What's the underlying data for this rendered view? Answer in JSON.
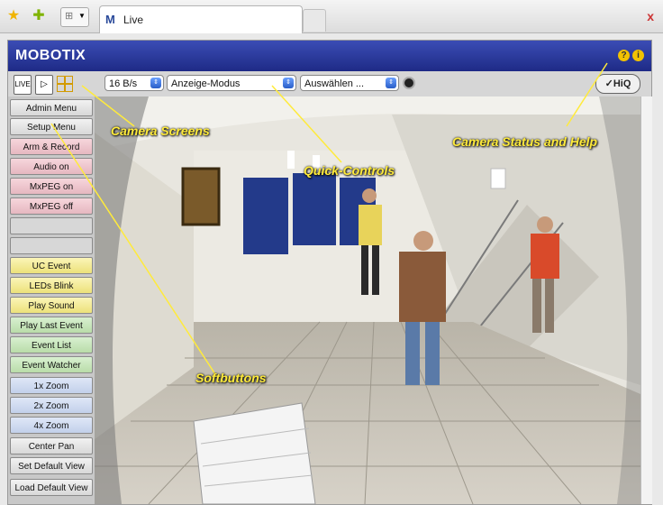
{
  "browser": {
    "tab_title": "Live",
    "close_symbol": "x"
  },
  "app": {
    "logo": "MOBOTIX",
    "help_symbol": "?",
    "info_symbol": "i"
  },
  "toolbar": {
    "rate": "16 B/s",
    "display_mode": "Anzeige-Modus",
    "select": "Auswählen ...",
    "quality": "✓HiQ",
    "live_btn": "LIVE"
  },
  "softbuttons": [
    {
      "label": "Admin Menu",
      "style": "g"
    },
    {
      "label": "Setup Menu",
      "style": "g"
    },
    {
      "label": "Arm & Record",
      "style": "p"
    },
    {
      "label": "Audio on",
      "style": "p"
    },
    {
      "label": "MxPEG on",
      "style": "p"
    },
    {
      "label": "MxPEG off",
      "style": "p"
    },
    {
      "label": "",
      "style": "e"
    },
    {
      "label": "",
      "style": "e"
    },
    {
      "label": "UC Event",
      "style": "y"
    },
    {
      "label": "LEDs Blink",
      "style": "y"
    },
    {
      "label": "Play Sound",
      "style": "y"
    },
    {
      "label": "Play Last Event",
      "style": "gr"
    },
    {
      "label": "Event List",
      "style": "gr"
    },
    {
      "label": "Event Watcher",
      "style": "gr"
    },
    {
      "label": "1x Zoom",
      "style": "b"
    },
    {
      "label": "2x Zoom",
      "style": "b"
    },
    {
      "label": "4x Zoom",
      "style": "b"
    },
    {
      "label": "Center Pan",
      "style": "g"
    },
    {
      "label": "Set Default View",
      "style": "g"
    },
    {
      "label": "Load Default View",
      "style": "g"
    }
  ],
  "callouts": {
    "camera_screens": "Camera Screens",
    "quick_controls": "Quick-Controls",
    "status_help": "Camera Status and Help",
    "softbuttons": "Softbuttons"
  },
  "colors": {
    "header_blue": "#1e2a86",
    "callout_yellow": "#ffeb3b"
  }
}
